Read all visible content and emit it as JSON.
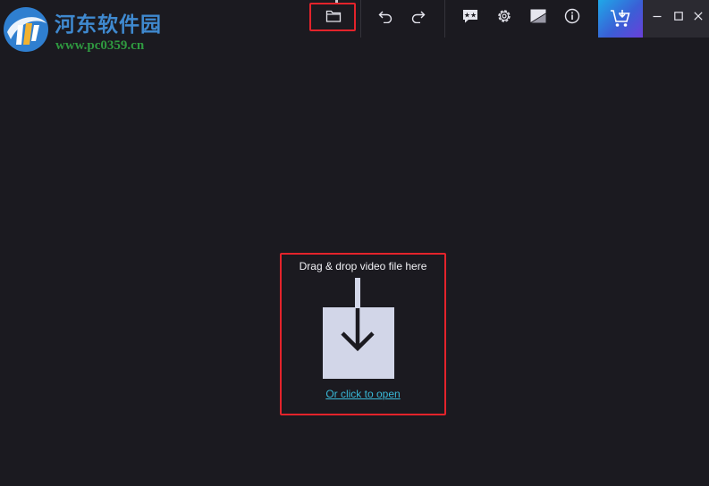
{
  "watermark": {
    "site_name": "河东软件园",
    "site_url": "www.pc0359.cn"
  },
  "toolbar": {
    "open_icon": "folder-icon",
    "undo_icon": "undo-icon",
    "redo_icon": "redo-icon",
    "feedback_icon": "feedback-chat-icon",
    "settings_icon": "gear-icon",
    "compare_icon": "split-view-icon",
    "info_icon": "info-icon",
    "cart_icon": "cart-icon"
  },
  "window_controls": {
    "minimize_icon": "minimize-icon",
    "maximize_icon": "maximize-icon",
    "close_icon": "close-icon"
  },
  "drop_zone": {
    "instruction": "Drag & drop video file here",
    "link_label": "Or click to open",
    "icon": "download-arrow-icon"
  },
  "colors": {
    "background": "#1b1a20",
    "highlight_border": "#e3232b",
    "link": "#39b9d8",
    "cart_gradient_start": "#1fa8e8",
    "cart_gradient_end": "#6a3fd9"
  }
}
